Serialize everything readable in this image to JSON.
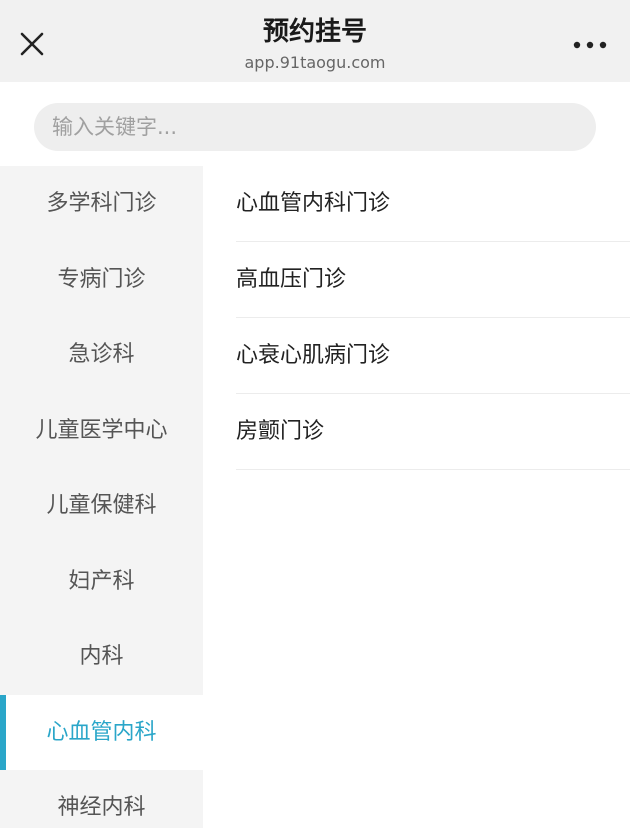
{
  "header": {
    "title": "预约挂号",
    "url": "app.91taogu.com"
  },
  "search": {
    "placeholder": "输入关键字..."
  },
  "sidebar": {
    "items": [
      {
        "label": "多学科门诊"
      },
      {
        "label": "专病门诊"
      },
      {
        "label": "急诊科"
      },
      {
        "label": "儿童医学中心"
      },
      {
        "label": "儿童保健科"
      },
      {
        "label": "妇产科"
      },
      {
        "label": "内科"
      },
      {
        "label": "心血管内科"
      },
      {
        "label": "神经内科"
      }
    ],
    "active_index": 7
  },
  "clinics": {
    "items": [
      {
        "label": "心血管内科门诊"
      },
      {
        "label": "高血压门诊"
      },
      {
        "label": "心衰心肌病门诊"
      },
      {
        "label": "房颤门诊"
      }
    ]
  },
  "colors": {
    "accent": "#2aa6c9",
    "header_bg": "#f1f1f1",
    "sidebar_bg": "#f4f4f4"
  },
  "icons": {
    "close": "close-icon",
    "more": "more-icon"
  }
}
